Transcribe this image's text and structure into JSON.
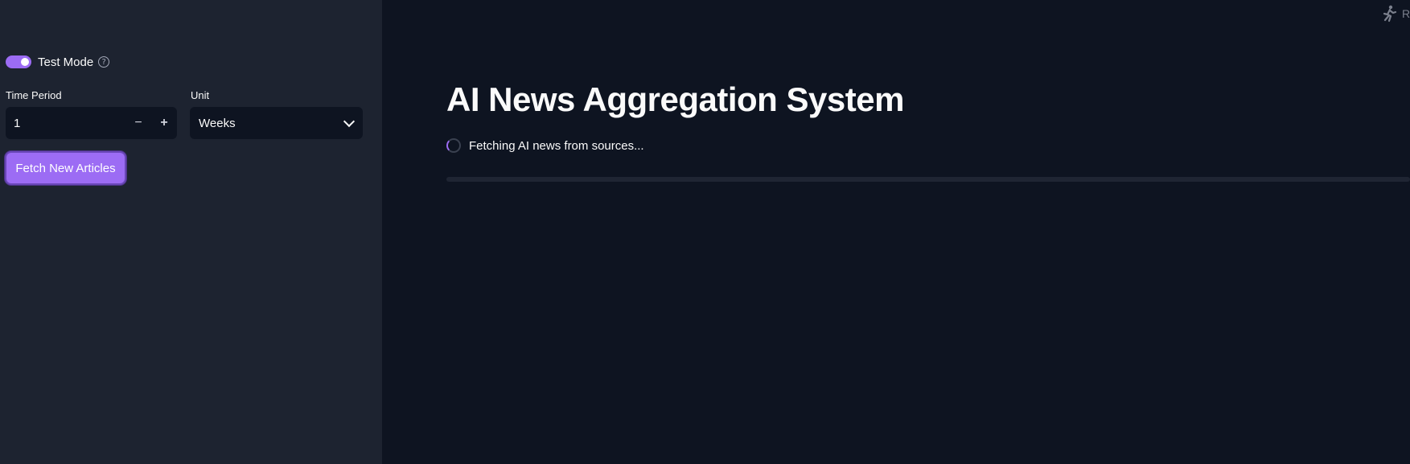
{
  "sidebar": {
    "test_mode": {
      "label": "Test Mode",
      "enabled": true,
      "help_icon": "question-circle-icon"
    },
    "time_period": {
      "label": "Time Period",
      "value": "1",
      "decrement_symbol": "−",
      "increment_symbol": "+"
    },
    "unit": {
      "label": "Unit",
      "value": "Weeks"
    },
    "fetch_button_label": "Fetch New Articles"
  },
  "main": {
    "title": "AI News Aggregation System",
    "status_text": "Fetching AI news from sources...",
    "progress": 0,
    "running_indicator": {
      "icon": "running-man-icon",
      "label": "R"
    }
  },
  "colors": {
    "accent": "#9c6cf4",
    "sidebar_bg": "#1d2330",
    "main_bg": "#0e1421"
  }
}
